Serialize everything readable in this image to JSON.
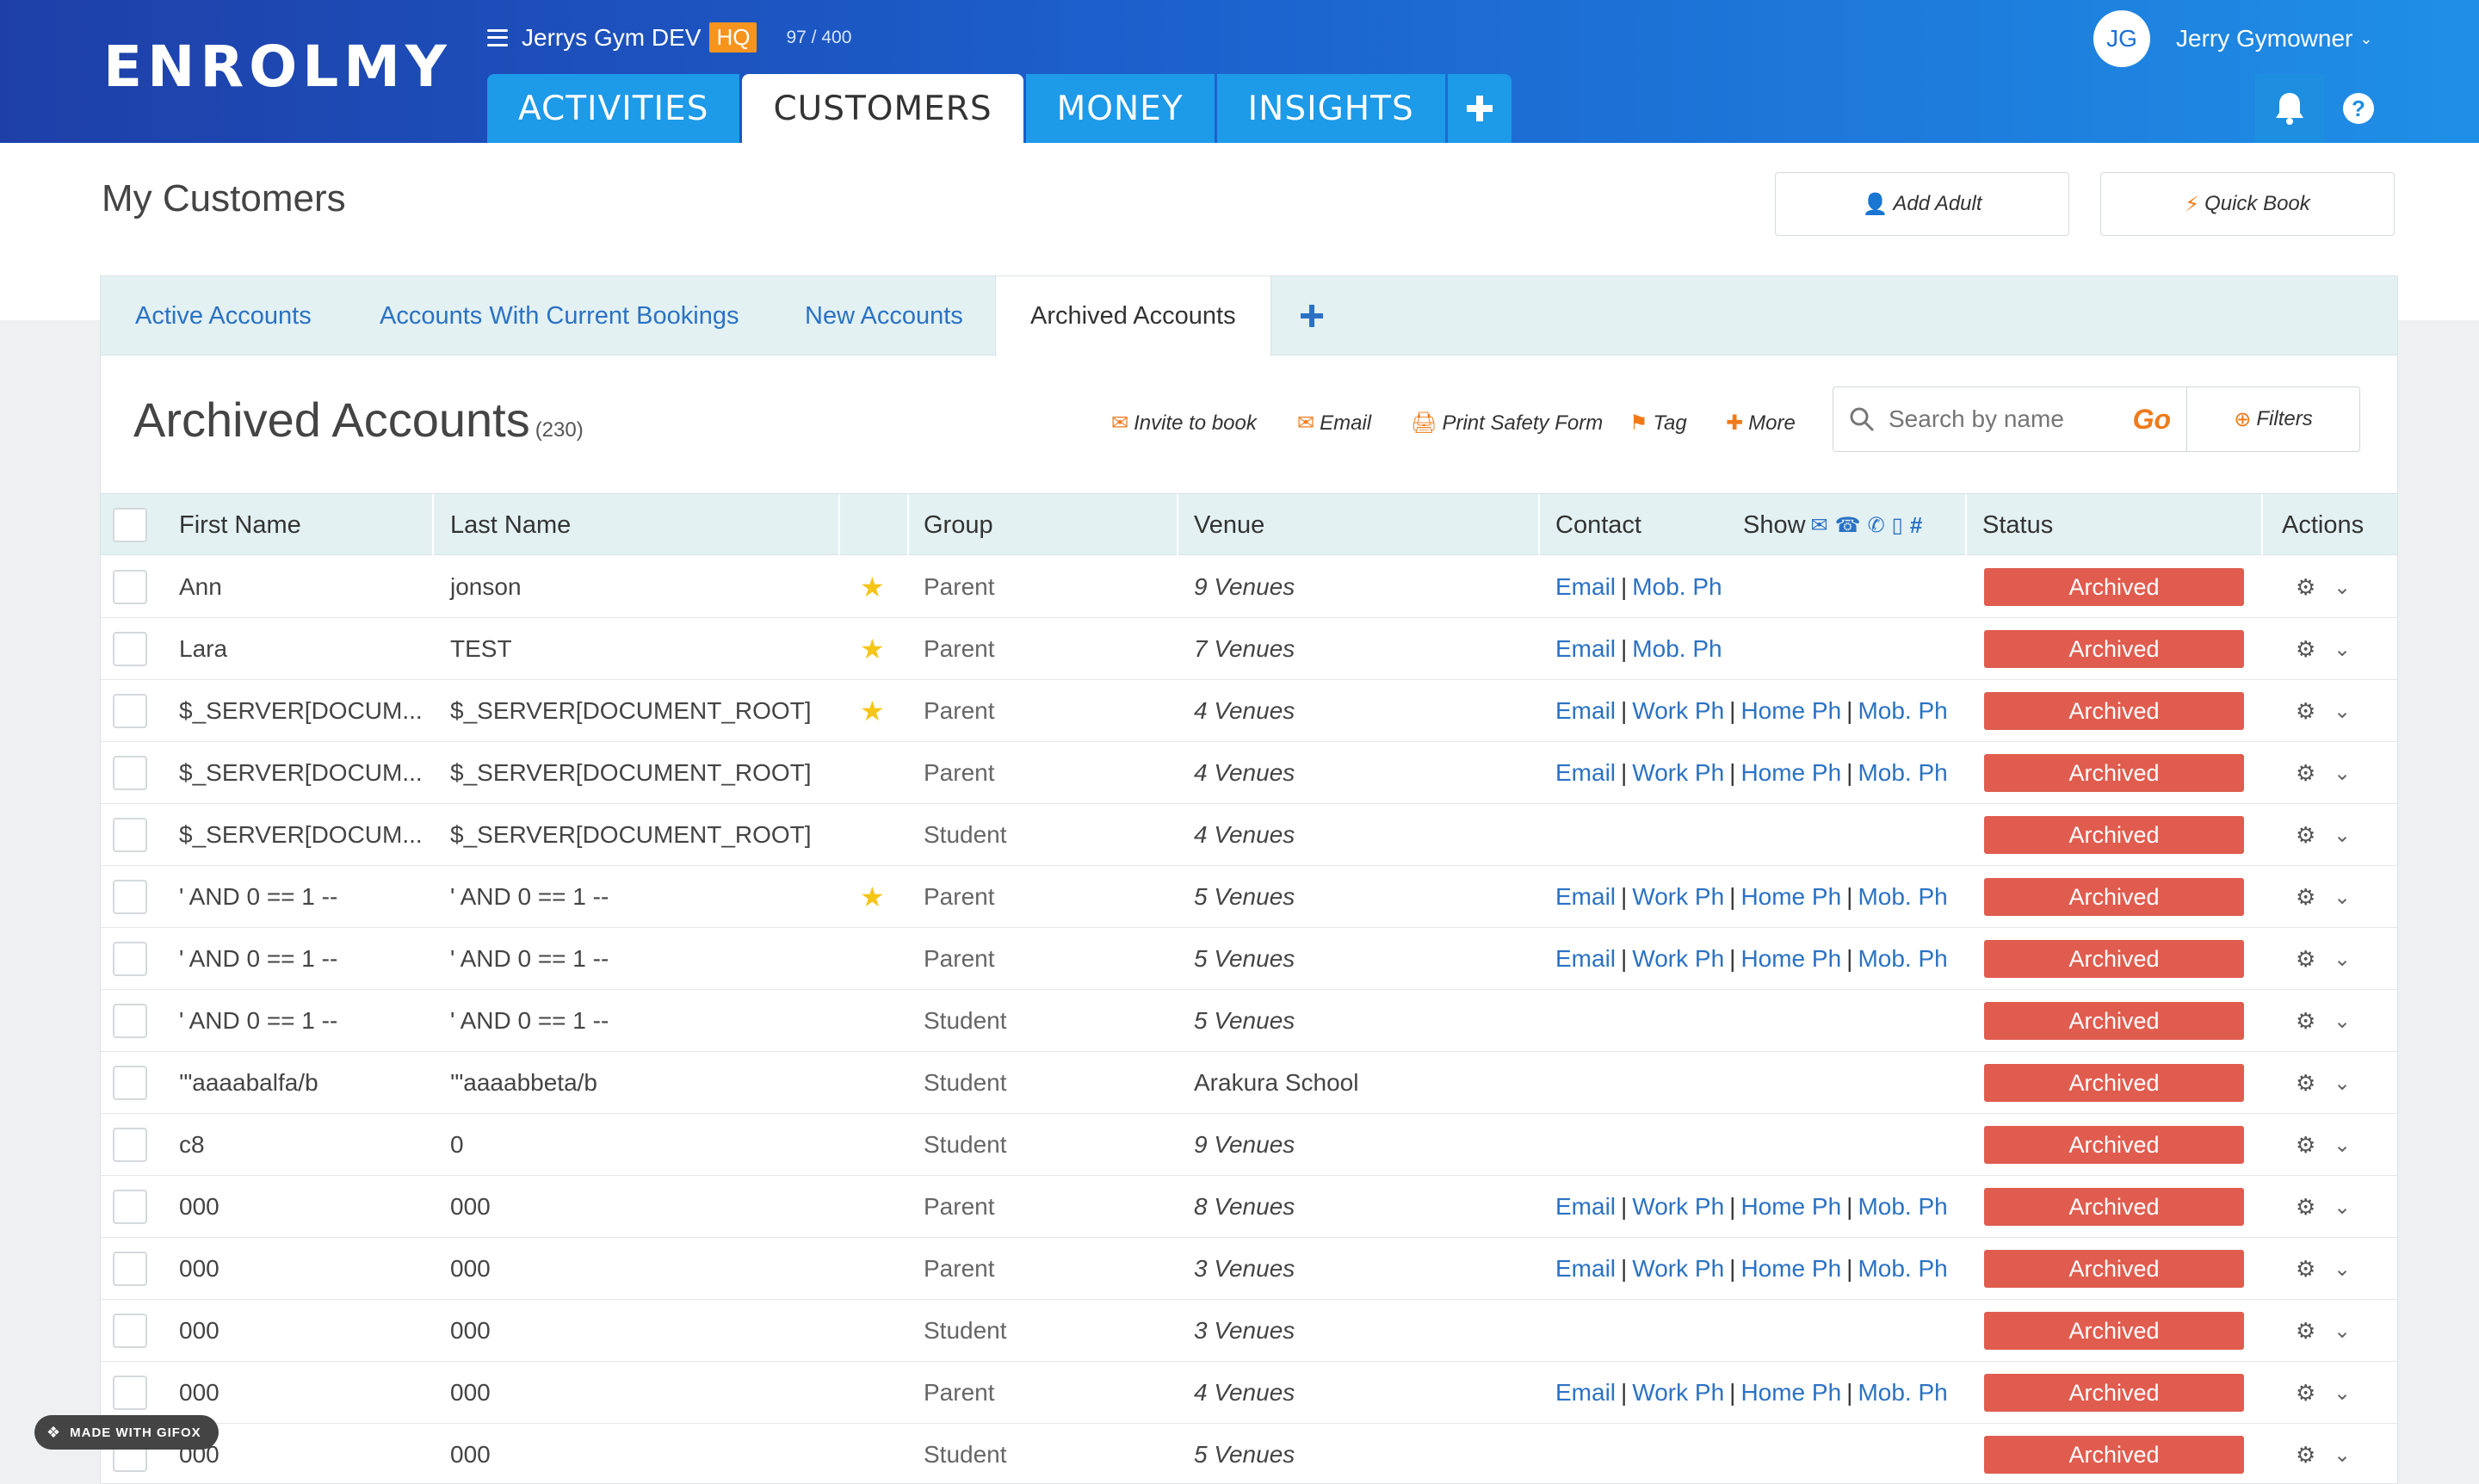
{
  "header": {
    "logo": "ENROLMY",
    "org_name": "Jerrys Gym DEV",
    "hq_badge": "HQ",
    "quota": "97 / 400",
    "user_initials": "JG",
    "user_name": "Jerry Gymowner",
    "tabs": [
      {
        "label": "ACTIVITIES",
        "active": false
      },
      {
        "label": "CUSTOMERS",
        "active": true
      },
      {
        "label": "MONEY",
        "active": false
      },
      {
        "label": "INSIGHTS",
        "active": false
      }
    ],
    "add_tab_icon": "plus-icon"
  },
  "page": {
    "title": "My Customers",
    "add_adult": "Add Adult",
    "quick_book": "Quick Book"
  },
  "subtabs": [
    {
      "label": "Active Accounts",
      "active": false
    },
    {
      "label": "Accounts With Current Bookings",
      "active": false
    },
    {
      "label": "New Accounts",
      "active": false
    },
    {
      "label": "Archived Accounts",
      "active": true
    }
  ],
  "section": {
    "title": "Archived Accounts",
    "count": "(230)"
  },
  "toolbar": {
    "invite": "Invite to book",
    "email": "Email",
    "print": "Print Safety Form",
    "tag": "Tag",
    "more": "More"
  },
  "search": {
    "placeholder": "Search by name",
    "go": "Go",
    "filters": "Filters"
  },
  "table": {
    "headers": {
      "first_name": "First Name",
      "last_name": "Last Name",
      "group": "Group",
      "venue": "Venue",
      "contact": "Contact",
      "show": "Show",
      "status": "Status",
      "actions": "Actions"
    },
    "rows": [
      {
        "first": "Ann",
        "last": "jonson",
        "star": true,
        "group": "Parent",
        "venue": "9 Venues",
        "venue_italic": true,
        "contacts": [
          "Email",
          "Mob. Ph"
        ],
        "status": "Archived"
      },
      {
        "first": "Lara",
        "last": "TEST",
        "star": true,
        "group": "Parent",
        "venue": "7 Venues",
        "venue_italic": true,
        "contacts": [
          "Email",
          "Mob. Ph"
        ],
        "status": "Archived"
      },
      {
        "first": "$_SERVER[DOCUM...",
        "last": "$_SERVER[DOCUMENT_ROOT]",
        "star": true,
        "group": "Parent",
        "venue": "4 Venues",
        "venue_italic": true,
        "contacts": [
          "Email",
          "Work Ph",
          "Home Ph",
          "Mob. Ph"
        ],
        "status": "Archived"
      },
      {
        "first": "$_SERVER[DOCUM...",
        "last": "$_SERVER[DOCUMENT_ROOT]",
        "star": false,
        "group": "Parent",
        "venue": "4 Venues",
        "venue_italic": true,
        "contacts": [
          "Email",
          "Work Ph",
          "Home Ph",
          "Mob. Ph"
        ],
        "status": "Archived"
      },
      {
        "first": "$_SERVER[DOCUM...",
        "last": "$_SERVER[DOCUMENT_ROOT]",
        "star": false,
        "group": "Student",
        "venue": "4 Venues",
        "venue_italic": true,
        "contacts": [],
        "status": "Archived"
      },
      {
        "first": "' AND 0 == 1 --",
        "last": "' AND 0 == 1 --",
        "star": true,
        "group": "Parent",
        "venue": "5 Venues",
        "venue_italic": true,
        "contacts": [
          "Email",
          "Work Ph",
          "Home Ph",
          "Mob. Ph"
        ],
        "status": "Archived"
      },
      {
        "first": "' AND 0 == 1 --",
        "last": "' AND 0 == 1 --",
        "star": false,
        "group": "Parent",
        "venue": "5 Venues",
        "venue_italic": true,
        "contacts": [
          "Email",
          "Work Ph",
          "Home Ph",
          "Mob. Ph"
        ],
        "status": "Archived"
      },
      {
        "first": "' AND 0 == 1 --",
        "last": "' AND 0 == 1 --",
        "star": false,
        "group": "Student",
        "venue": "5 Venues",
        "venue_italic": true,
        "contacts": [],
        "status": "Archived"
      },
      {
        "first": "'\"aaaabalfa/b",
        "last": "'\"aaaabbeta/b",
        "star": false,
        "group": "Student",
        "venue": "Arakura School",
        "venue_italic": false,
        "contacts": [],
        "status": "Archived"
      },
      {
        "first": "c8",
        "last": "0",
        "star": false,
        "group": "Student",
        "venue": "9 Venues",
        "venue_italic": true,
        "contacts": [],
        "status": "Archived"
      },
      {
        "first": "000",
        "last": "000",
        "star": false,
        "group": "Parent",
        "venue": "8 Venues",
        "venue_italic": true,
        "contacts": [
          "Email",
          "Work Ph",
          "Home Ph",
          "Mob. Ph"
        ],
        "status": "Archived"
      },
      {
        "first": "000",
        "last": "000",
        "star": false,
        "group": "Parent",
        "venue": "3 Venues",
        "venue_italic": true,
        "contacts": [
          "Email",
          "Work Ph",
          "Home Ph",
          "Mob. Ph"
        ],
        "status": "Archived"
      },
      {
        "first": "000",
        "last": "000",
        "star": false,
        "group": "Student",
        "venue": "3 Venues",
        "venue_italic": true,
        "contacts": [],
        "status": "Archived"
      },
      {
        "first": "000",
        "last": "000",
        "star": false,
        "group": "Parent",
        "venue": "4 Venues",
        "venue_italic": true,
        "contacts": [
          "Email",
          "Work Ph",
          "Home Ph",
          "Mob. Ph"
        ],
        "status": "Archived"
      },
      {
        "first": "000",
        "last": "000",
        "star": false,
        "group": "Student",
        "venue": "5 Venues",
        "venue_italic": true,
        "contacts": [],
        "status": "Archived"
      }
    ]
  },
  "watermark": "MADE WITH GIFOX",
  "colors": {
    "header_start": "#1e3fa8",
    "header_end": "#1f8fe6",
    "tab_blue": "#1d9ae8",
    "accent_orange": "#f07a1a",
    "archived_red": "#e05c4f",
    "link_blue": "#2b72c4",
    "table_header_bg": "#e3f1f2"
  }
}
